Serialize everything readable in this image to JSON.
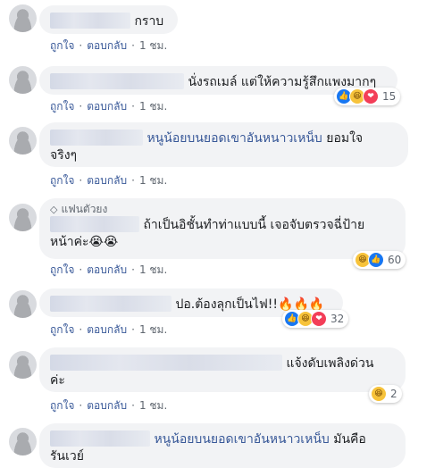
{
  "colors": {
    "link": "#385898",
    "meta": "#606770",
    "bubble": "#f2f3f5",
    "like": "#1877f2",
    "haha": "#f7c33b",
    "love": "#f33e58"
  },
  "actions": {
    "like": "ถูกใจ",
    "reply": "ตอบกลับ",
    "sep": "·"
  },
  "comments": [
    {
      "text": "กราบ",
      "time": "1 ชม."
    },
    {
      "text": "นั่งรถเมล์ แต่ให้ความรู้สึกแพงมากๆ",
      "time": "1 ชม.",
      "reaction_count": "15"
    },
    {
      "tag": "หนูน้อยบนยอดเขาอันหนาวเหน็บ",
      "text": "ยอมใจ",
      "text2": "จริงๆ",
      "time": "1 ชม."
    },
    {
      "badge": "แฟนตัวยง",
      "text": "ถ้าเป็นอิชั้นทำท่าแบบนี้ เจอจับตรวจฉี่ป้าย",
      "text2": "หน้าค่ะ😭😭",
      "time": "1 ชม.",
      "reaction_count": "60"
    },
    {
      "text": "ปอ.ต้องลุกเป็นไฟ!!🔥🔥🔥",
      "time": "1 ชม.",
      "reaction_count": "32"
    },
    {
      "text": "แจ้งดับเพลิงด่วน",
      "text2": "ค่ะ",
      "time": "1 ชม.",
      "reaction_count": "2"
    },
    {
      "tag": "หนูน้อยบนยอดเขาอันหนาวเหน็บ",
      "text": "มันคือ",
      "text2": "รันเวย์"
    }
  ]
}
